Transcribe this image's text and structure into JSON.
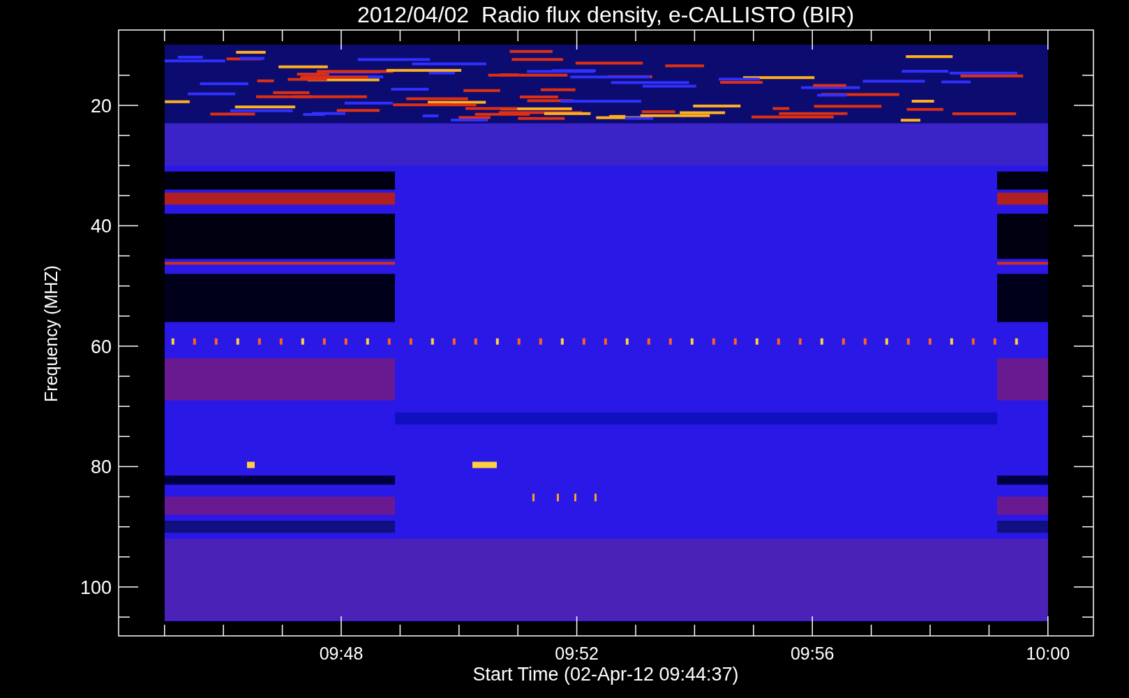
{
  "title": "2012/04/02  Radio flux density, e-CALLISTO (BIR)",
  "y_axis": {
    "label": "Frequency (MHZ)",
    "ticks": [
      "20",
      "40",
      "60",
      "80",
      "100"
    ]
  },
  "x_axis": {
    "label": "Start Time (02-Apr-12 09:44:37)",
    "ticks": [
      "09:48",
      "09:52",
      "09:56",
      "10:00"
    ]
  }
}
